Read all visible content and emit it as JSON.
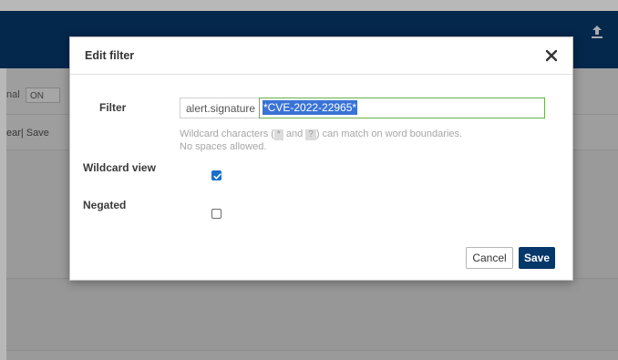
{
  "background": {
    "frag_nal": "nal",
    "on_button": "ON",
    "links": "ear| Save"
  },
  "modal": {
    "title": "Edit filter",
    "close_icon": "close-icon",
    "filter": {
      "label": "Filter",
      "prefix": "alert.signature",
      "value": "*CVE-2022-22965*",
      "hint_before": "Wildcard characters (",
      "hint_star": "*",
      "hint_and": " and ",
      "hint_q": "?",
      "hint_after": ") can match on word boundaries.",
      "hint2": "No spaces allowed."
    },
    "wildcard": {
      "label": "Wildcard view",
      "checked": true
    },
    "negated": {
      "label": "Negated",
      "checked": false
    },
    "buttons": {
      "cancel": "Cancel",
      "save": "Save"
    }
  },
  "colors": {
    "topbar": "#06376a",
    "primary": "#06376a",
    "checkbox": "#1a6fc9",
    "input_border": "#6ab04c",
    "selection": "#3a73d6"
  }
}
